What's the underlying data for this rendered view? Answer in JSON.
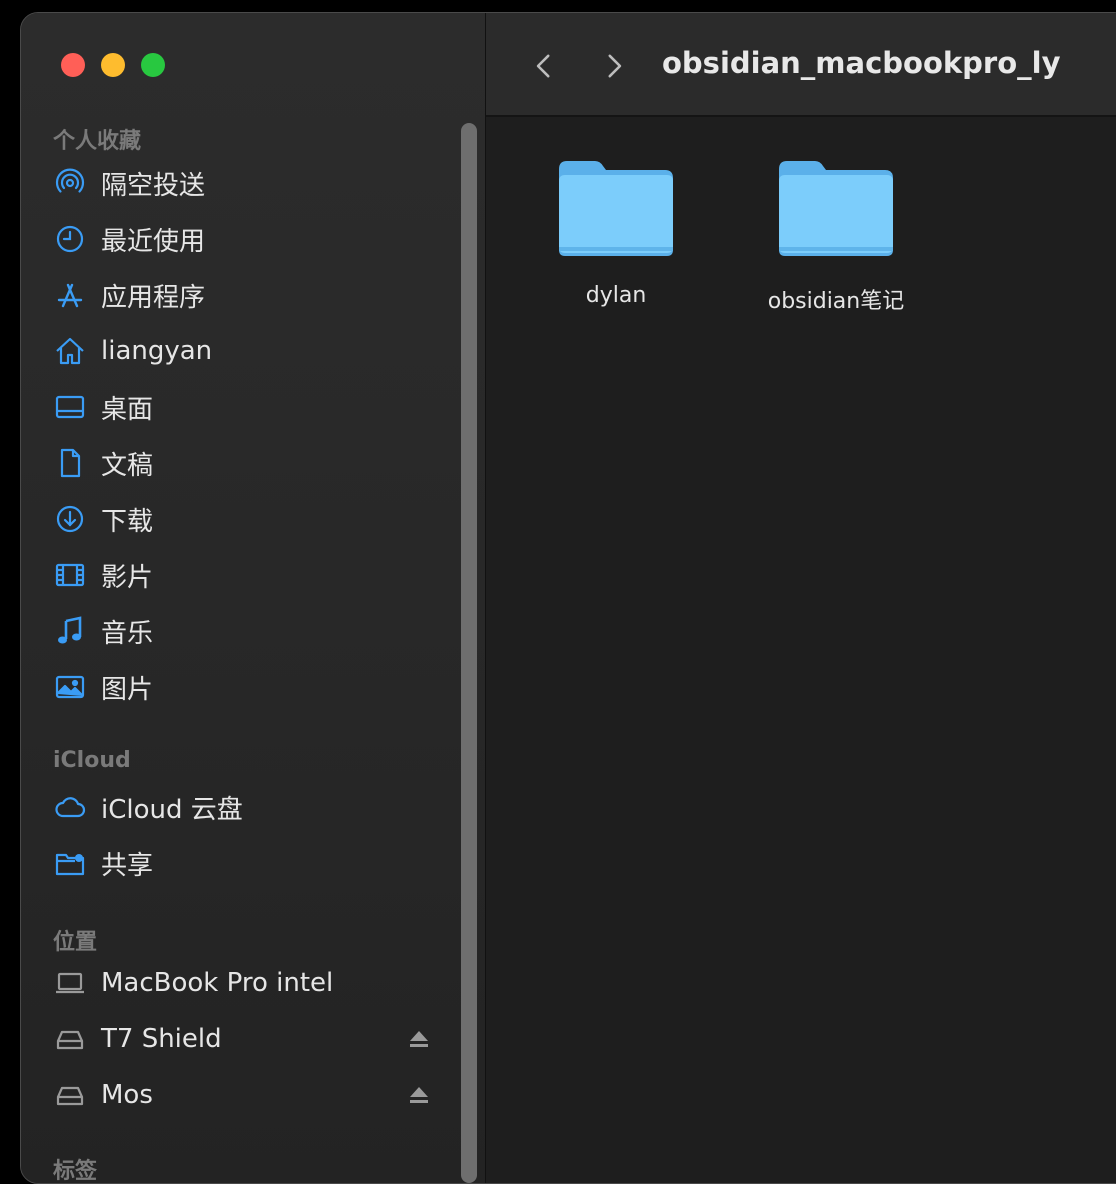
{
  "window": {
    "title": "obsidian_macbookpro_ly"
  },
  "sidebar": {
    "favorites_title": "个人收藏",
    "favorites": [
      {
        "label": "隔空投送",
        "icon": "airdrop-icon"
      },
      {
        "label": "最近使用",
        "icon": "clock-icon"
      },
      {
        "label": "应用程序",
        "icon": "applications-icon"
      },
      {
        "label": "liangyan",
        "icon": "home-icon"
      },
      {
        "label": "桌面",
        "icon": "desktop-icon"
      },
      {
        "label": "文稿",
        "icon": "document-icon"
      },
      {
        "label": "下载",
        "icon": "download-icon"
      },
      {
        "label": "影片",
        "icon": "film-icon"
      },
      {
        "label": "音乐",
        "icon": "music-icon"
      },
      {
        "label": "图片",
        "icon": "photo-icon"
      }
    ],
    "icloud_title": "iCloud",
    "icloud": [
      {
        "label": "iCloud 云盘",
        "icon": "cloud-icon"
      },
      {
        "label": "共享",
        "icon": "shared-folder-icon"
      }
    ],
    "locations_title": "位置",
    "locations": [
      {
        "label": "MacBook Pro intel",
        "icon": "laptop-icon"
      },
      {
        "label": "T7 Shield",
        "icon": "drive-icon",
        "eject": true
      },
      {
        "label": "Mos",
        "icon": "drive-icon",
        "eject": true
      }
    ],
    "tags_title": "标签"
  },
  "content": {
    "folders": [
      {
        "name": "dylan"
      },
      {
        "name": "obsidian笔记"
      }
    ]
  },
  "colors": {
    "accent": "#1e90ff",
    "folder": "#6cc4f5",
    "sidebar_bg": "#2a2a2a",
    "content_bg": "#1e1e1e"
  }
}
